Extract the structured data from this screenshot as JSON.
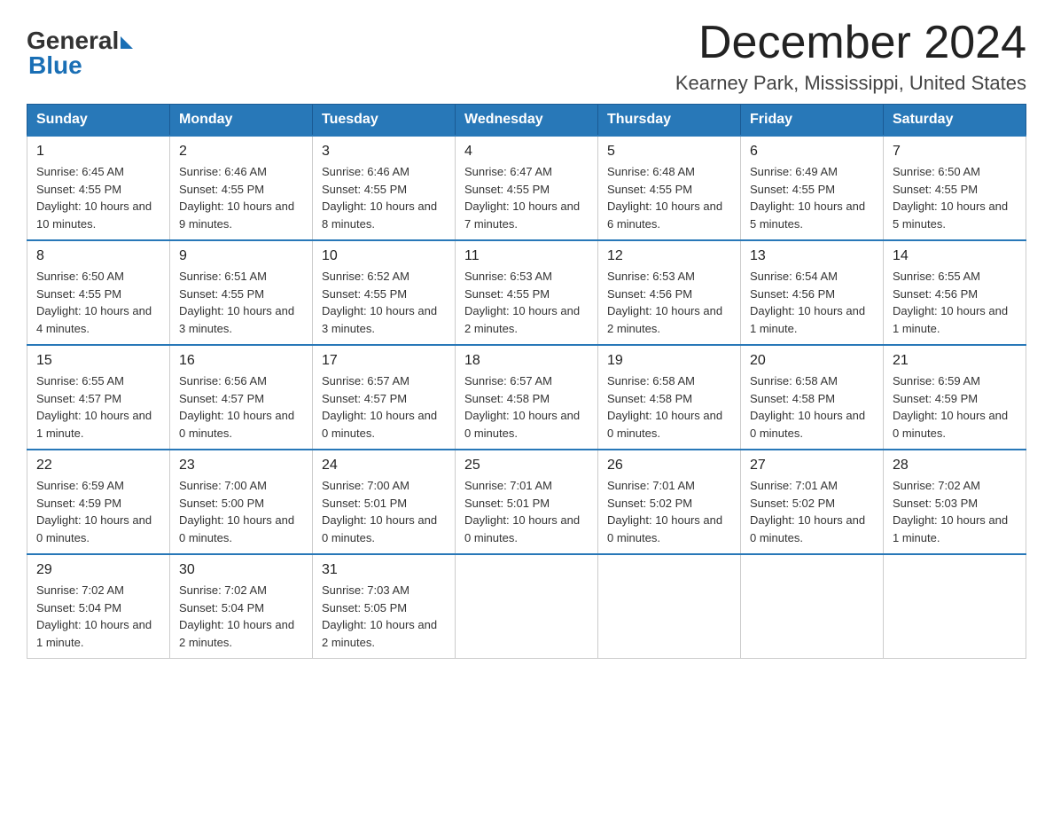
{
  "header": {
    "logo": {
      "general": "General",
      "blue": "Blue"
    },
    "title": "December 2024",
    "subtitle": "Kearney Park, Mississippi, United States"
  },
  "weekdays": [
    "Sunday",
    "Monday",
    "Tuesday",
    "Wednesday",
    "Thursday",
    "Friday",
    "Saturday"
  ],
  "weeks": [
    [
      {
        "day": "1",
        "sunrise": "6:45 AM",
        "sunset": "4:55 PM",
        "daylight": "10 hours and 10 minutes."
      },
      {
        "day": "2",
        "sunrise": "6:46 AM",
        "sunset": "4:55 PM",
        "daylight": "10 hours and 9 minutes."
      },
      {
        "day": "3",
        "sunrise": "6:46 AM",
        "sunset": "4:55 PM",
        "daylight": "10 hours and 8 minutes."
      },
      {
        "day": "4",
        "sunrise": "6:47 AM",
        "sunset": "4:55 PM",
        "daylight": "10 hours and 7 minutes."
      },
      {
        "day": "5",
        "sunrise": "6:48 AM",
        "sunset": "4:55 PM",
        "daylight": "10 hours and 6 minutes."
      },
      {
        "day": "6",
        "sunrise": "6:49 AM",
        "sunset": "4:55 PM",
        "daylight": "10 hours and 5 minutes."
      },
      {
        "day": "7",
        "sunrise": "6:50 AM",
        "sunset": "4:55 PM",
        "daylight": "10 hours and 5 minutes."
      }
    ],
    [
      {
        "day": "8",
        "sunrise": "6:50 AM",
        "sunset": "4:55 PM",
        "daylight": "10 hours and 4 minutes."
      },
      {
        "day": "9",
        "sunrise": "6:51 AM",
        "sunset": "4:55 PM",
        "daylight": "10 hours and 3 minutes."
      },
      {
        "day": "10",
        "sunrise": "6:52 AM",
        "sunset": "4:55 PM",
        "daylight": "10 hours and 3 minutes."
      },
      {
        "day": "11",
        "sunrise": "6:53 AM",
        "sunset": "4:55 PM",
        "daylight": "10 hours and 2 minutes."
      },
      {
        "day": "12",
        "sunrise": "6:53 AM",
        "sunset": "4:56 PM",
        "daylight": "10 hours and 2 minutes."
      },
      {
        "day": "13",
        "sunrise": "6:54 AM",
        "sunset": "4:56 PM",
        "daylight": "10 hours and 1 minute."
      },
      {
        "day": "14",
        "sunrise": "6:55 AM",
        "sunset": "4:56 PM",
        "daylight": "10 hours and 1 minute."
      }
    ],
    [
      {
        "day": "15",
        "sunrise": "6:55 AM",
        "sunset": "4:57 PM",
        "daylight": "10 hours and 1 minute."
      },
      {
        "day": "16",
        "sunrise": "6:56 AM",
        "sunset": "4:57 PM",
        "daylight": "10 hours and 0 minutes."
      },
      {
        "day": "17",
        "sunrise": "6:57 AM",
        "sunset": "4:57 PM",
        "daylight": "10 hours and 0 minutes."
      },
      {
        "day": "18",
        "sunrise": "6:57 AM",
        "sunset": "4:58 PM",
        "daylight": "10 hours and 0 minutes."
      },
      {
        "day": "19",
        "sunrise": "6:58 AM",
        "sunset": "4:58 PM",
        "daylight": "10 hours and 0 minutes."
      },
      {
        "day": "20",
        "sunrise": "6:58 AM",
        "sunset": "4:58 PM",
        "daylight": "10 hours and 0 minutes."
      },
      {
        "day": "21",
        "sunrise": "6:59 AM",
        "sunset": "4:59 PM",
        "daylight": "10 hours and 0 minutes."
      }
    ],
    [
      {
        "day": "22",
        "sunrise": "6:59 AM",
        "sunset": "4:59 PM",
        "daylight": "10 hours and 0 minutes."
      },
      {
        "day": "23",
        "sunrise": "7:00 AM",
        "sunset": "5:00 PM",
        "daylight": "10 hours and 0 minutes."
      },
      {
        "day": "24",
        "sunrise": "7:00 AM",
        "sunset": "5:01 PM",
        "daylight": "10 hours and 0 minutes."
      },
      {
        "day": "25",
        "sunrise": "7:01 AM",
        "sunset": "5:01 PM",
        "daylight": "10 hours and 0 minutes."
      },
      {
        "day": "26",
        "sunrise": "7:01 AM",
        "sunset": "5:02 PM",
        "daylight": "10 hours and 0 minutes."
      },
      {
        "day": "27",
        "sunrise": "7:01 AM",
        "sunset": "5:02 PM",
        "daylight": "10 hours and 0 minutes."
      },
      {
        "day": "28",
        "sunrise": "7:02 AM",
        "sunset": "5:03 PM",
        "daylight": "10 hours and 1 minute."
      }
    ],
    [
      {
        "day": "29",
        "sunrise": "7:02 AM",
        "sunset": "5:04 PM",
        "daylight": "10 hours and 1 minute."
      },
      {
        "day": "30",
        "sunrise": "7:02 AM",
        "sunset": "5:04 PM",
        "daylight": "10 hours and 2 minutes."
      },
      {
        "day": "31",
        "sunrise": "7:03 AM",
        "sunset": "5:05 PM",
        "daylight": "10 hours and 2 minutes."
      },
      null,
      null,
      null,
      null
    ]
  ],
  "labels": {
    "sunrise": "Sunrise:",
    "sunset": "Sunset:",
    "daylight": "Daylight:"
  }
}
